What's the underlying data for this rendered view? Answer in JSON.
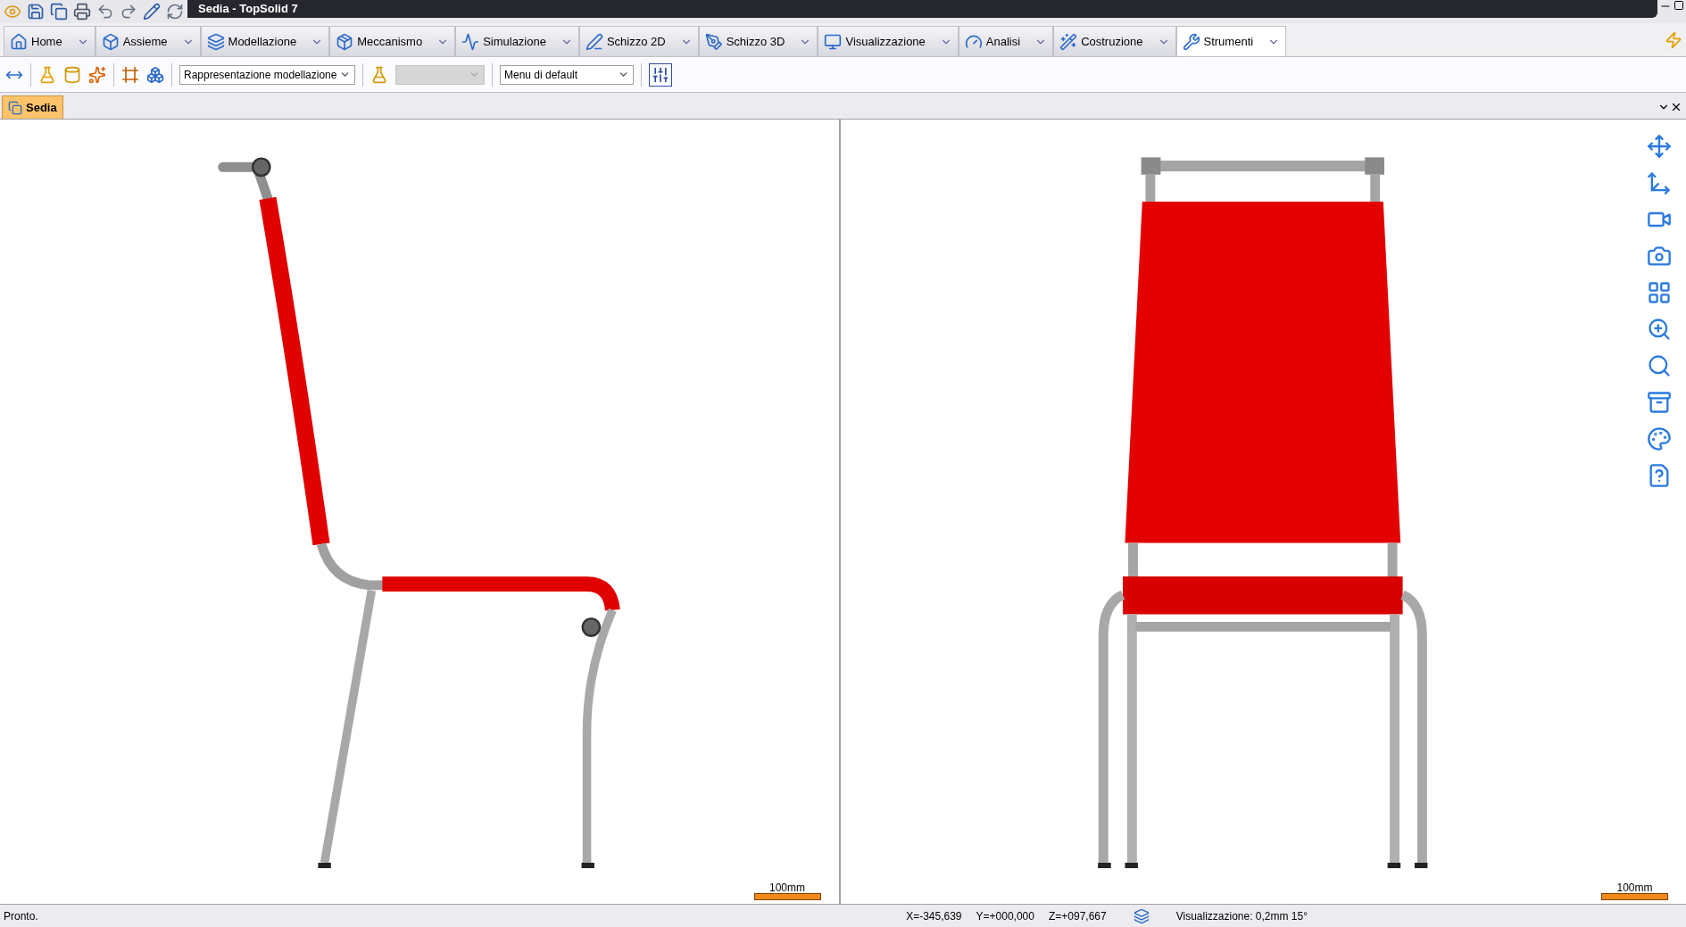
{
  "window": {
    "title": "Sedia - TopSolid 7"
  },
  "ribbon_tabs": [
    {
      "label": "Home",
      "selected": false
    },
    {
      "label": "Assieme",
      "selected": false
    },
    {
      "label": "Modellazione",
      "selected": false
    },
    {
      "label": "Meccanismo",
      "selected": false
    },
    {
      "label": "Simulazione",
      "selected": false
    },
    {
      "label": "Schizzo 2D",
      "selected": false
    },
    {
      "label": "Schizzo 3D",
      "selected": false
    },
    {
      "label": "Visualizzazione",
      "selected": false
    },
    {
      "label": "Analisi",
      "selected": false
    },
    {
      "label": "Costruzione",
      "selected": false
    },
    {
      "label": "Strumenti",
      "selected": true
    }
  ],
  "toolbar": {
    "representation_dropdown": {
      "value": "Rappresentazione modellazione",
      "disabled": false
    },
    "empty_dropdown": {
      "disabled": true
    },
    "menu_dropdown": {
      "value": "Menu di default",
      "disabled": false
    }
  },
  "document_tabs": [
    {
      "label": "Sedia",
      "selected": true
    }
  ],
  "viewports": [
    {
      "kind": "side",
      "scale_label": "100mm"
    },
    {
      "kind": "front",
      "scale_label": "100mm"
    }
  ],
  "status_bar": {
    "message": "Pronto.",
    "x": "X=-345,639",
    "y": "Y=+000,000",
    "z": "Z=+097,667",
    "display": "Visualizzazione: 0,2mm 15°"
  }
}
